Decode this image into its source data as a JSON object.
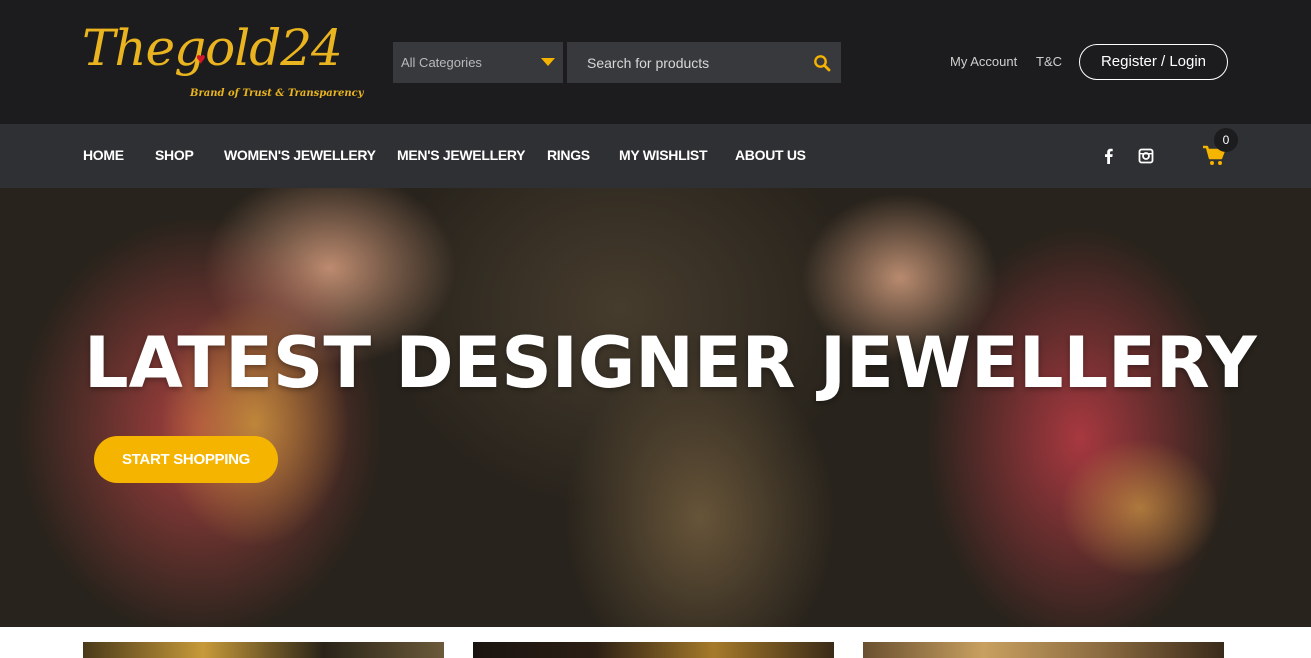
{
  "header": {
    "logo_text": "Thegold24",
    "logo_tagline": "Brand of Trust & Transparency",
    "category_select": "All Categories",
    "search_placeholder": "Search for products",
    "my_account": "My Account",
    "tc": "T&C",
    "login_label": "Register / Login"
  },
  "nav": {
    "items": [
      "HOME",
      "SHOP",
      "WOMEN'S JEWELLERY",
      "MEN'S JEWELLERY",
      "RINGS",
      "MY WISHLIST",
      "ABOUT US"
    ],
    "cart_count": "0"
  },
  "hero": {
    "title": "LATEST DESIGNER JEWELLERY",
    "cta_label": "START SHOPPING"
  },
  "colors": {
    "accent": "#f5b400",
    "header_bg": "#1c1c1e",
    "nav_bg": "#2f3033"
  },
  "icons": {
    "search": "search-icon",
    "dropdown": "caret-down-icon",
    "facebook": "facebook-icon",
    "instagram": "instagram-icon",
    "cart": "cart-icon"
  }
}
